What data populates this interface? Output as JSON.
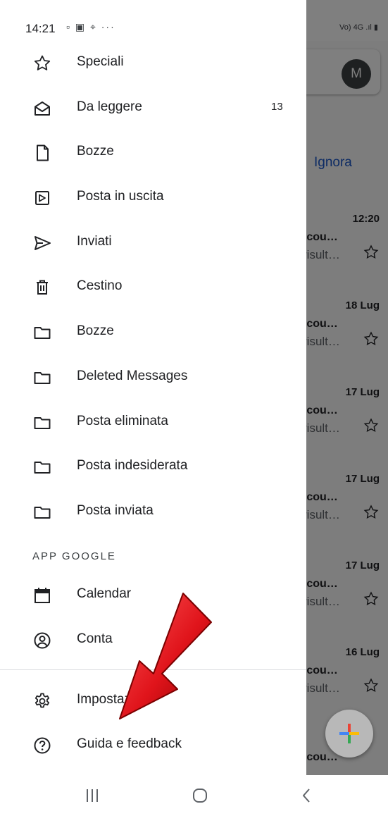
{
  "status_bar": {
    "time": "14:21",
    "left_icons": "▫ ▣ ⌖ ···",
    "right_icons": "Vo) 4G .ıl ▮"
  },
  "inbox": {
    "avatar_letter": "M",
    "ignore_label": "Ignora",
    "emails": [
      {
        "time": "12:20",
        "sender": ":cou…",
        "snippet": "risult…"
      },
      {
        "time": "18 Lug",
        "sender": ":cou…",
        "snippet": "risult…"
      },
      {
        "time": "17 Lug",
        "sender": ":cou…",
        "snippet": "risult…"
      },
      {
        "time": "17 Lug",
        "sender": ":cou…",
        "snippet": "risult…"
      },
      {
        "time": "17 Lug",
        "sender": ":cou…",
        "snippet": "risult…"
      },
      {
        "time": "16 Lug",
        "sender": ":cou…",
        "snippet": "risult…"
      },
      {
        "time": "",
        "sender": ":cou…",
        "snippet": ""
      }
    ]
  },
  "drawer": {
    "items": [
      {
        "label": "Speciali",
        "icon": "star-icon"
      },
      {
        "label": "Da leggere",
        "icon": "mail-open-icon",
        "count": "13"
      },
      {
        "label": "Bozze",
        "icon": "file-icon"
      },
      {
        "label": "Posta in uscita",
        "icon": "outbox-icon"
      },
      {
        "label": "Inviati",
        "icon": "send-icon"
      },
      {
        "label": "Cestino",
        "icon": "trash-icon"
      },
      {
        "label": "Bozze",
        "icon": "folder-icon"
      },
      {
        "label": "Deleted Messages",
        "icon": "folder-icon"
      },
      {
        "label": "Posta eliminata",
        "icon": "folder-icon"
      },
      {
        "label": "Posta indesiderata",
        "icon": "folder-icon"
      },
      {
        "label": "Posta inviata",
        "icon": "folder-icon"
      }
    ],
    "section_header": "APP GOOGLE",
    "apps": [
      {
        "label": "Calendar",
        "icon": "calendar-icon"
      },
      {
        "label": "Conta",
        "icon": "contacts-icon"
      }
    ],
    "footer": [
      {
        "label": "Impostazioni",
        "icon": "settings-icon"
      },
      {
        "label": "Guida e feedback",
        "icon": "help-icon"
      }
    ]
  },
  "colors": {
    "drawer_bg": "#ffffff",
    "text_primary": "#202124",
    "link_blue": "#1a57c8",
    "arrow_red": "#e0141b"
  },
  "bottom_nav": {
    "icons": [
      "recent-apps-icon",
      "home-icon",
      "back-icon"
    ]
  }
}
